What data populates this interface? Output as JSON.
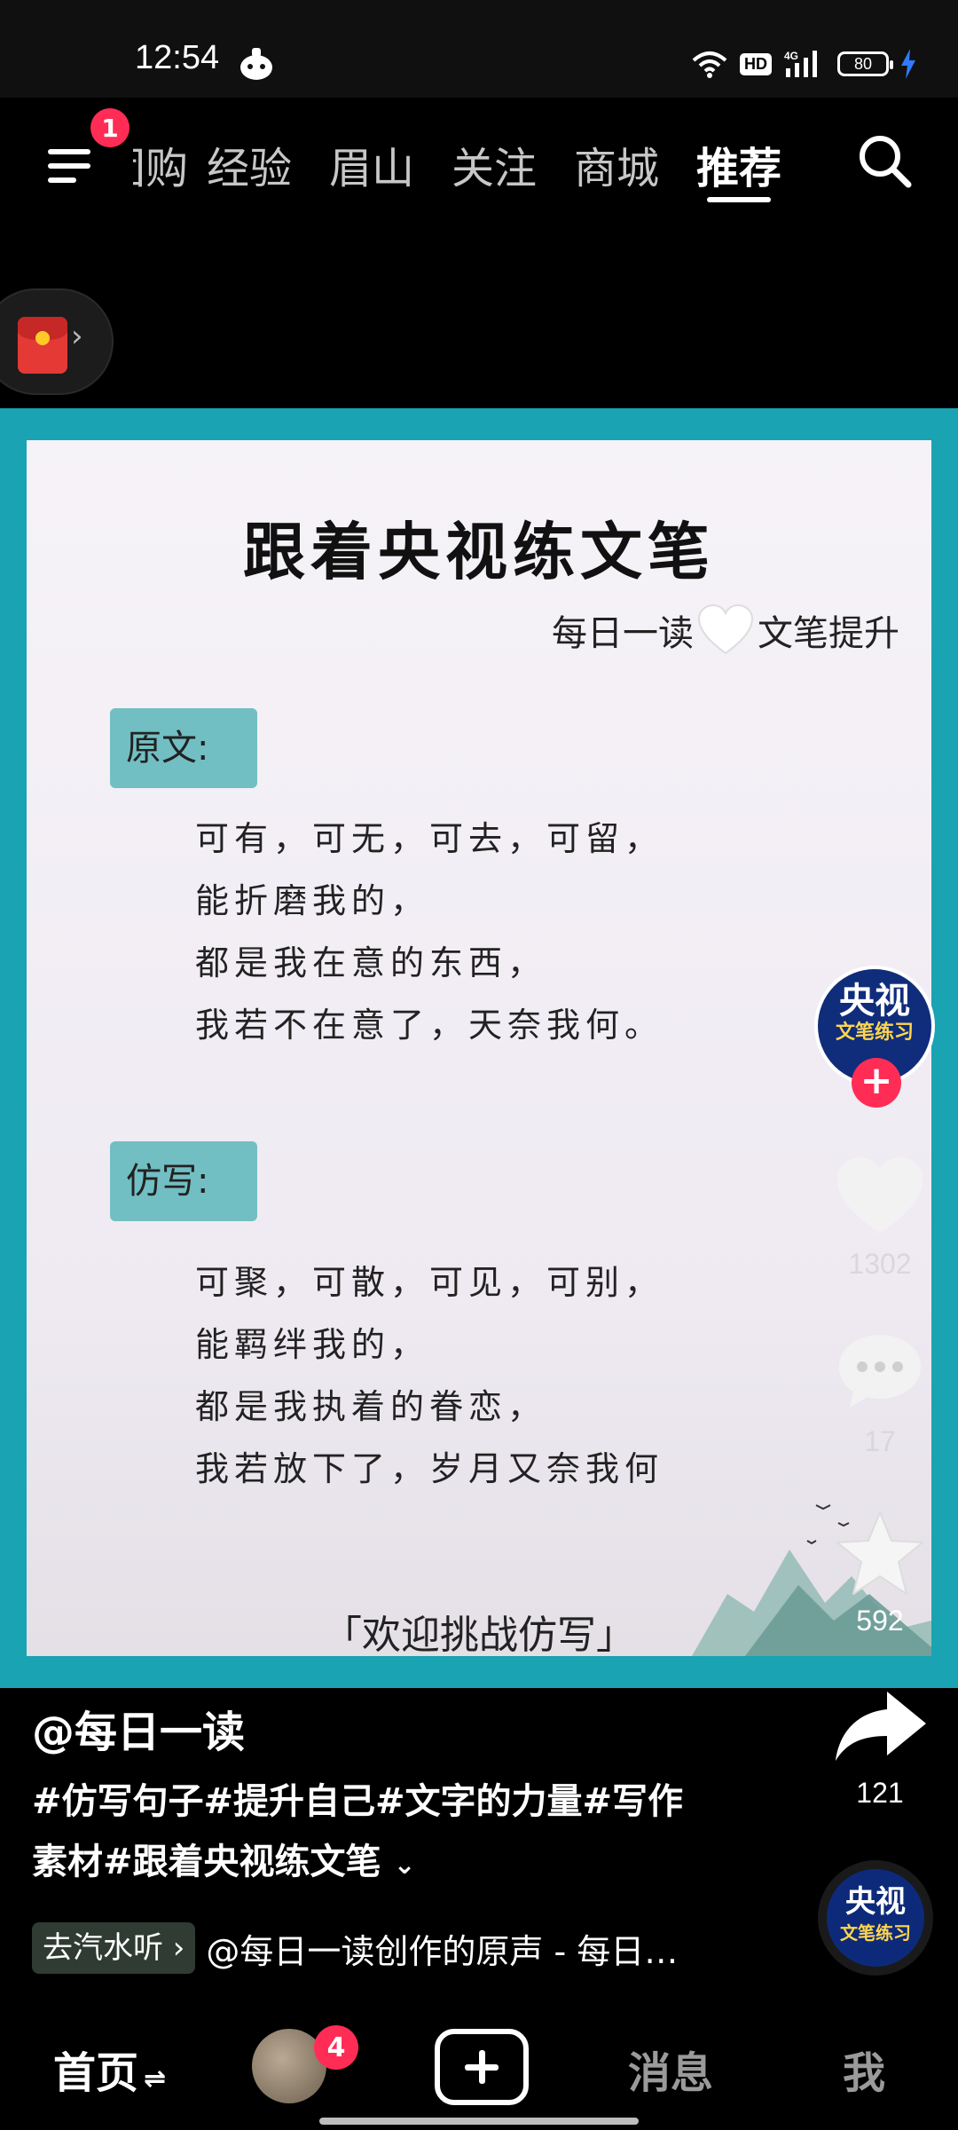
{
  "status": {
    "time": "12:54",
    "hd": "HD",
    "network": "4G",
    "battery": "80"
  },
  "nav": {
    "menu_badge": "1",
    "tabs": [
      "团购",
      "经验",
      "眉山",
      "关注",
      "商城",
      "推荐"
    ],
    "active_tab": "推荐"
  },
  "poster": {
    "title": "跟着央视练文笔",
    "subtitle_left": "每日一读",
    "subtitle_right": "文笔提升",
    "original_label": "原文:",
    "original_lines": [
      "可有，可无，可去，可留，",
      "能折磨我的，",
      "都是我在意的东西，",
      "我若不在意了，天奈我何。"
    ],
    "imitation_label": "仿写:",
    "imitation_lines": [
      "可聚，可散，可见，可别，",
      "能羁绊我的，",
      "都是我执着的眷恋，",
      "我若放下了，岁月又奈我何"
    ],
    "footer": "「欢迎挑战仿写」"
  },
  "creator": {
    "avatar_line1": "央视",
    "avatar_line2": "文笔练习"
  },
  "actions": {
    "likes": "1302",
    "comments": "17",
    "favorites": "592",
    "shares": "121"
  },
  "caption": {
    "author": "@每日一读",
    "text": "#仿写句子#提升自己#文字的力量#写作素材#跟着央视练文笔",
    "expand_symbol": "⌄",
    "music_chip": "去汽水听 ›",
    "music_text": "@每日一读创作的原声 - 每日…"
  },
  "bottom_nav": {
    "home": "首页",
    "home_switch": "⇌",
    "friends_badge": "4",
    "messages": "消息",
    "me": "我"
  },
  "colors": {
    "frame": "#1aa3b2",
    "label_bg": "#72bfc3",
    "badge": "#ff2d55",
    "creator": "#0f2d7a"
  },
  "icons": [
    "wifi-icon",
    "signal-icon",
    "battery-icon",
    "menu-icon",
    "search-icon",
    "red-packet-icon",
    "heart-icon",
    "comment-icon",
    "star-icon",
    "share-icon",
    "plus-icon"
  ]
}
